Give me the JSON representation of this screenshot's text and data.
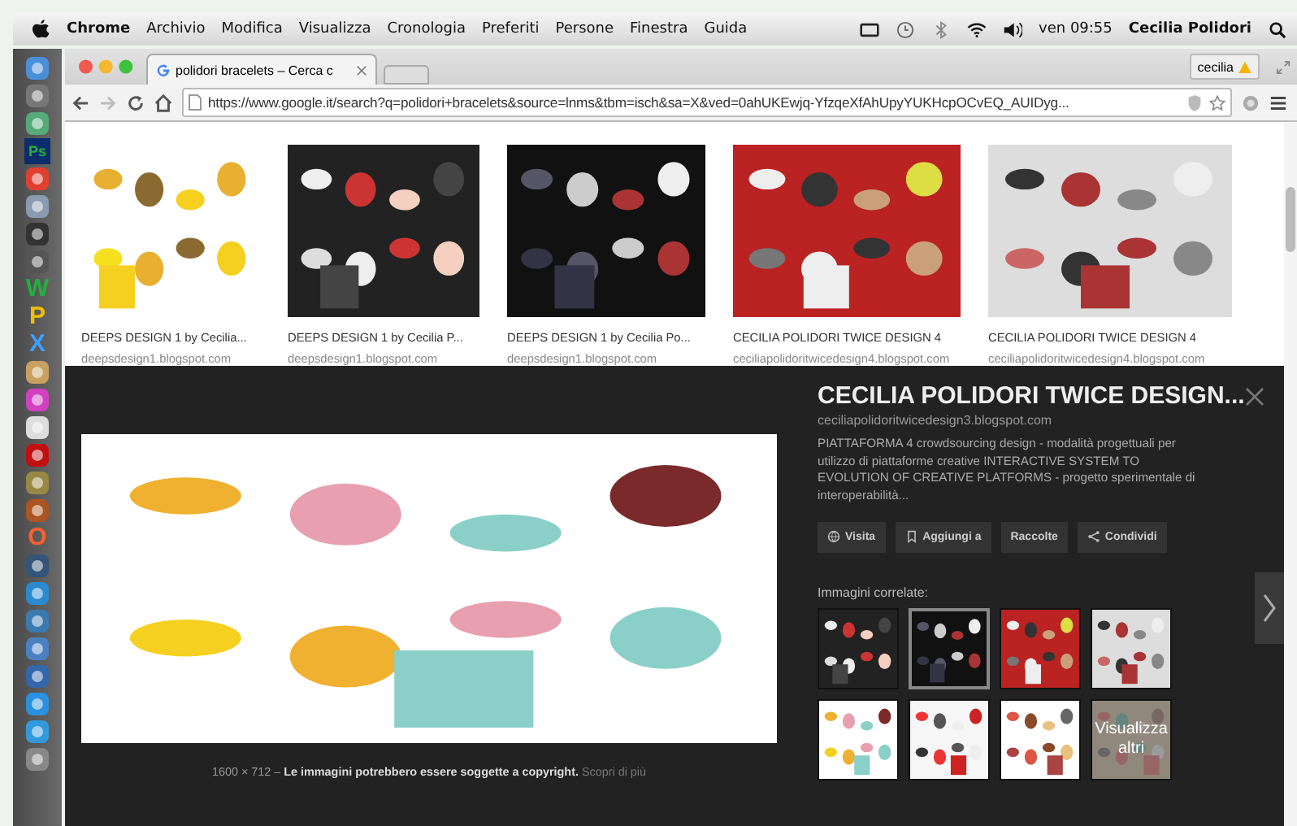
{
  "menu_bar": {
    "app": "Chrome",
    "menus": [
      "Archivio",
      "Modifica",
      "Visualizza",
      "Cronologia",
      "Preferiti",
      "Persone",
      "Finestra",
      "Guida"
    ],
    "clock": "ven 09:55",
    "user": "Cecilia Polidori"
  },
  "dock": [
    {
      "kind": "icon"
    },
    {
      "kind": "icon"
    },
    {
      "kind": "icon"
    },
    {
      "kind": "letter",
      "glyph": "Ps"
    },
    {
      "kind": "icon"
    },
    {
      "kind": "icon"
    },
    {
      "kind": "icon"
    },
    {
      "kind": "icon"
    },
    {
      "kind": "letter",
      "glyph": "W"
    },
    {
      "kind": "letter",
      "glyph": "P"
    },
    {
      "kind": "letter",
      "glyph": "X"
    },
    {
      "kind": "icon"
    },
    {
      "kind": "icon"
    },
    {
      "kind": "icon"
    },
    {
      "kind": "icon"
    },
    {
      "kind": "icon"
    },
    {
      "kind": "icon"
    },
    {
      "kind": "letter",
      "glyph": "O"
    },
    {
      "kind": "icon"
    },
    {
      "kind": "icon"
    },
    {
      "kind": "icon"
    },
    {
      "kind": "icon"
    },
    {
      "kind": "icon"
    },
    {
      "kind": "icon"
    },
    {
      "kind": "icon"
    },
    {
      "kind": "icon"
    }
  ],
  "browser": {
    "tab": {
      "title": "polidori bracelets – Cerca c",
      "selected": true
    },
    "profile": "cecilia",
    "url": "https://www.google.it/search?q=polidori+bracelets&source=lnms&tbm=isch&sa=X&ved=0ahUKEwjq-YfzqeXfAhUpyYUKHcpOCvEQ_AUIDyg..."
  },
  "results": [
    {
      "title": "DEEPS DESIGN 1 by Cecilia...",
      "source": "deepsdesign1.blogspot.com"
    },
    {
      "title": "DEEPS DESIGN 1 by Cecilia P...",
      "source": "deepsdesign1.blogspot.com"
    },
    {
      "title": "DEEPS DESIGN 1 by Cecilia Po...",
      "source": "deepsdesign1.blogspot.com"
    },
    {
      "title": "CECILIA POLIDORI TWICE DESIGN 4",
      "source": "ceciliapolidoritwicedesign4.blogspot.com"
    },
    {
      "title": "CECILIA POLIDORI TWICE DESIGN 4",
      "source": "ceciliapolidoritwicedesign4.blogspot.com"
    }
  ],
  "preview": {
    "title": "CECILIA POLIDORI TWICE DESIGN...",
    "source": "ceciliapolidoritwicedesign3.blogspot.com",
    "description": "PIATTAFORMA 4 crowdsourcing design - modalità progettuali per utilizzo di piattaforme creative INTERACTIVE SYSTEM TO EVOLUTION OF CREATIVE PLATFORMS - progetto sperimentale di interoperabilità...",
    "actions": [
      {
        "kind": "visit",
        "label": "Visita"
      },
      {
        "kind": "save",
        "label": "Aggiungi a"
      },
      {
        "kind": "plain",
        "label": "Raccolte"
      },
      {
        "kind": "share",
        "label": "Condividi"
      }
    ],
    "related_label": "Immagini correlate:",
    "related": [
      {
        "selected": false
      },
      {
        "selected": true
      },
      {
        "selected": false
      },
      {
        "selected": false
      },
      {
        "selected": false
      },
      {
        "selected": false
      },
      {
        "selected": false
      },
      {
        "selected": false,
        "overlay": "Visualizza altri"
      }
    ],
    "caption": "1600 × 712 – **Le immagini potrebbero essere soggette a copyright.**",
    "caption_link": "Scopri di più"
  }
}
